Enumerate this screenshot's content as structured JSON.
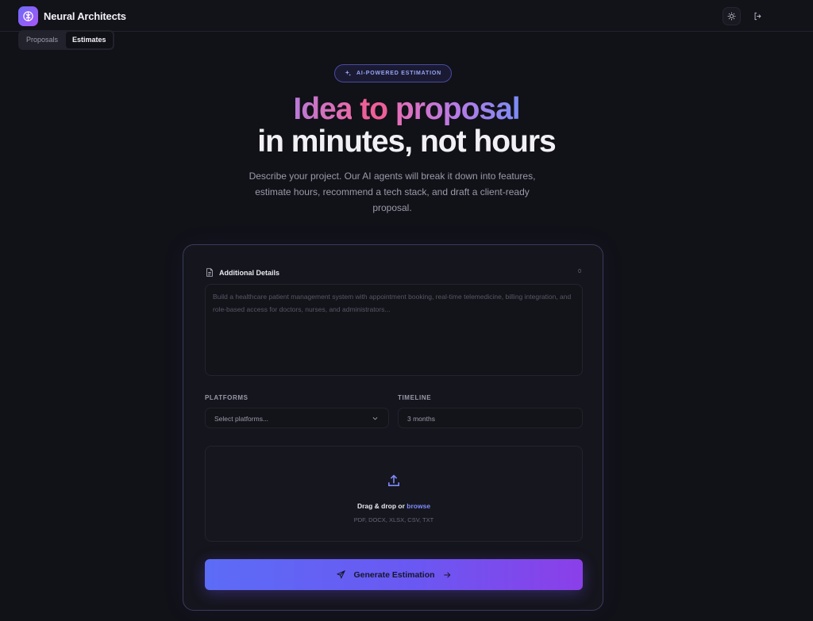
{
  "app": {
    "name": "Neural Architects"
  },
  "tabs": [
    {
      "label": "Proposals",
      "active": false
    },
    {
      "label": "Estimates",
      "active": true
    }
  ],
  "hero": {
    "badge": "AI-POWERED ESTIMATION",
    "title_word_1": "Idea",
    "title_word_2": "to",
    "title_word_3": "proposal",
    "title_line_2": "in minutes, not hours",
    "subtitle": "Describe your project. Our AI agents will break it down into features, estimate hours, recommend a tech stack, and draft a client-ready proposal."
  },
  "form": {
    "details_label": "Additional Details",
    "char_count": "0",
    "details_placeholder": "Build a healthcare patient management system with appointment booking, real-time telemedicine, billing integration, and role-based access for doctors, nurses, and administrators...",
    "platforms_label": "PLATFORMS",
    "platforms_placeholder": "Select platforms...",
    "timeline_label": "TIMELINE",
    "timeline_value": "3 months",
    "drop_text": "Drag & drop or",
    "drop_link": "browse",
    "formats": "PDF, DOCX, XLSX, CSV, TXT",
    "generate_label": "Generate Estimation"
  },
  "icons": {
    "logo": "brain-icon",
    "theme": "sun-icon",
    "logout": "logout-icon",
    "badge": "sparkles-icon",
    "details": "document-icon",
    "dropdown": "chevron-down-icon",
    "upload": "upload-icon",
    "send": "send-icon",
    "arrow": "arrow-right-icon"
  },
  "colors": {
    "background": "#111118",
    "accent": "#7f8cff",
    "button_start": "#5c6cf6",
    "button_end": "#8b3fe8"
  }
}
